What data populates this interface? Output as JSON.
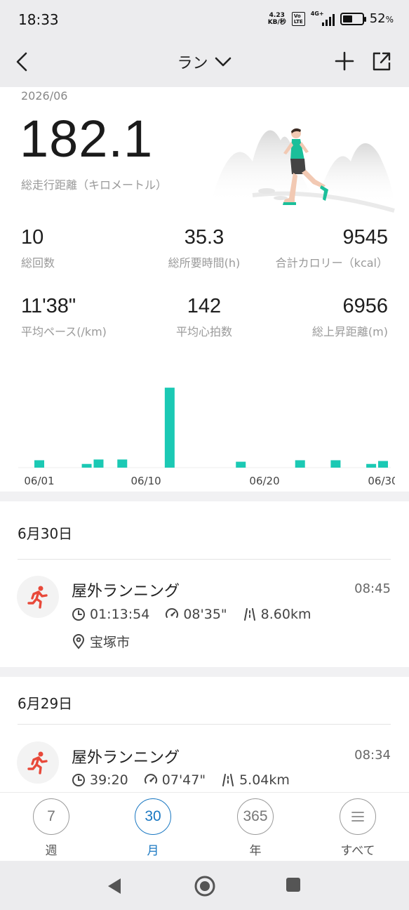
{
  "status_bar": {
    "time": "18:33",
    "net_speed_top": "4.23",
    "net_speed_bottom": "KB/秒",
    "volte_top": "Vo",
    "volte_bottom": "LTE",
    "network": "4G+",
    "battery": "52",
    "battery_unit": "%"
  },
  "app_bar": {
    "title": "ラン",
    "back_icon": "chevron-left-icon",
    "dropdown_icon": "chevron-down-icon",
    "add_icon": "plus-icon",
    "share_icon": "share-icon"
  },
  "summary": {
    "month": "2026/06",
    "total_distance": "182.1",
    "total_distance_label": "総走行距離（キロメートル）",
    "stats": [
      {
        "value": "10",
        "label": "総回数"
      },
      {
        "value": "35.3",
        "label": "総所要時間(h)"
      },
      {
        "value": "9545",
        "label": "合計カロリー（kcal）"
      },
      {
        "value": "11'38\"",
        "label": "平均ペース(/km)"
      },
      {
        "value": "142",
        "label": "平均心拍数"
      },
      {
        "value": "6956",
        "label": "総上昇距離(m)"
      }
    ]
  },
  "chart_data": {
    "type": "bar",
    "x": [
      1,
      5,
      6,
      8,
      12,
      18,
      23,
      26,
      29,
      30
    ],
    "values": [
      1,
      0.5,
      1.1,
      1.1,
      10.8,
      0.8,
      1,
      1,
      0.5,
      0.9
    ],
    "xlim": [
      1,
      30
    ],
    "ylim": [
      0,
      11
    ],
    "tick_labels": [
      {
        "day": 1,
        "label": "06/01"
      },
      {
        "day": 10,
        "label": "06/10"
      },
      {
        "day": 20,
        "label": "06/20"
      },
      {
        "day": 30,
        "label": "06/30"
      }
    ],
    "color": "#1bc9b4",
    "grid": false
  },
  "activities": [
    {
      "date": "6月30日",
      "title": "屋外ランニング",
      "time": "08:45",
      "duration": "01:13:54",
      "pace": "08'35\"",
      "distance": "8.60km",
      "location": "宝塚市"
    },
    {
      "date": "6月29日",
      "title": "屋外ランニング",
      "time": "08:34",
      "duration": "39:20",
      "pace": "07'47\"",
      "distance": "5.04km"
    }
  ],
  "tabs": [
    {
      "number": "7",
      "label": "週",
      "active": false
    },
    {
      "number": "30",
      "label": "月",
      "active": true
    },
    {
      "number": "365",
      "label": "年",
      "active": false
    },
    {
      "number": "",
      "label": "すべて",
      "active": false,
      "icon": "menu-icon"
    }
  ],
  "colors": {
    "accent": "#1bc9b4",
    "tab_active": "#1a78c2",
    "run_icon": "#e8493a"
  }
}
